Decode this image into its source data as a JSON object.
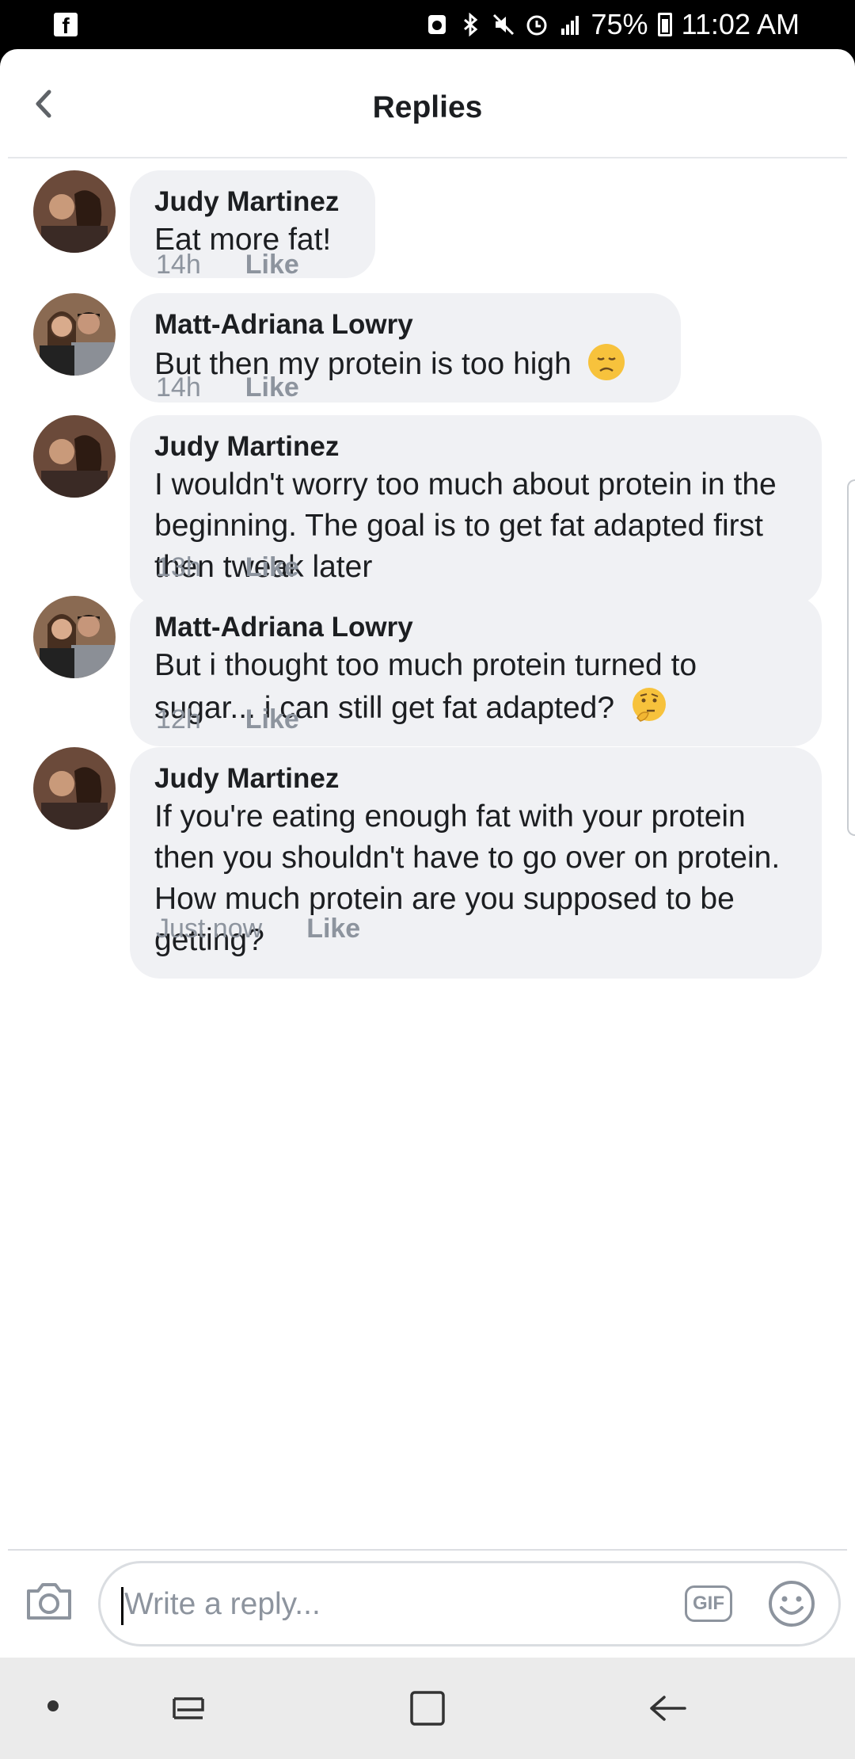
{
  "status_bar": {
    "app_icon": "facebook-icon",
    "icons": [
      "data-saver-icon",
      "bluetooth-icon",
      "mute-icon",
      "alarm-icon",
      "lte-signal-icon"
    ],
    "battery": "75%",
    "time": "11:02 AM"
  },
  "header": {
    "title": "Replies",
    "back_icon": "chevron-left-icon"
  },
  "comments": [
    {
      "author": "Judy Martinez",
      "text": "Eat more fat!",
      "emoji": "",
      "time": "14h",
      "like": "Like"
    },
    {
      "author": "Matt-Adriana Lowry",
      "text": "But then my protein is too high",
      "emoji": "disappointed-face",
      "time": "14h",
      "like": "Like"
    },
    {
      "author": "Judy Martinez",
      "text": "I wouldn't worry too much about protein in the beginning.  The goal is to get fat adapted first then tweak later",
      "emoji": "",
      "time": "13h",
      "like": "Like"
    },
    {
      "author": "Matt-Adriana Lowry",
      "text": "But i thought too much protein turned to sugar... i can still get fat adapted?",
      "emoji": "thinking-face",
      "time": "12h",
      "like": "Like"
    },
    {
      "author": "Judy Martinez",
      "text": "If you're eating enough fat with your protein then you shouldn't have to go over on protein.  How much protein are you supposed to be getting?",
      "emoji": "",
      "time": "Just now",
      "like": "Like"
    }
  ],
  "composer": {
    "placeholder": "Write a reply...",
    "gif_label": "GIF",
    "camera_icon": "camera-icon",
    "emoji_icon": "smiley-icon"
  },
  "nav_bar": {
    "icons": [
      "dot-icon",
      "recent-apps-icon",
      "home-icon",
      "back-arrow-icon"
    ]
  },
  "colors": {
    "bubble": "#f0f1f4",
    "meta_text": "#8d949e",
    "primary_text": "#1c1e21"
  }
}
